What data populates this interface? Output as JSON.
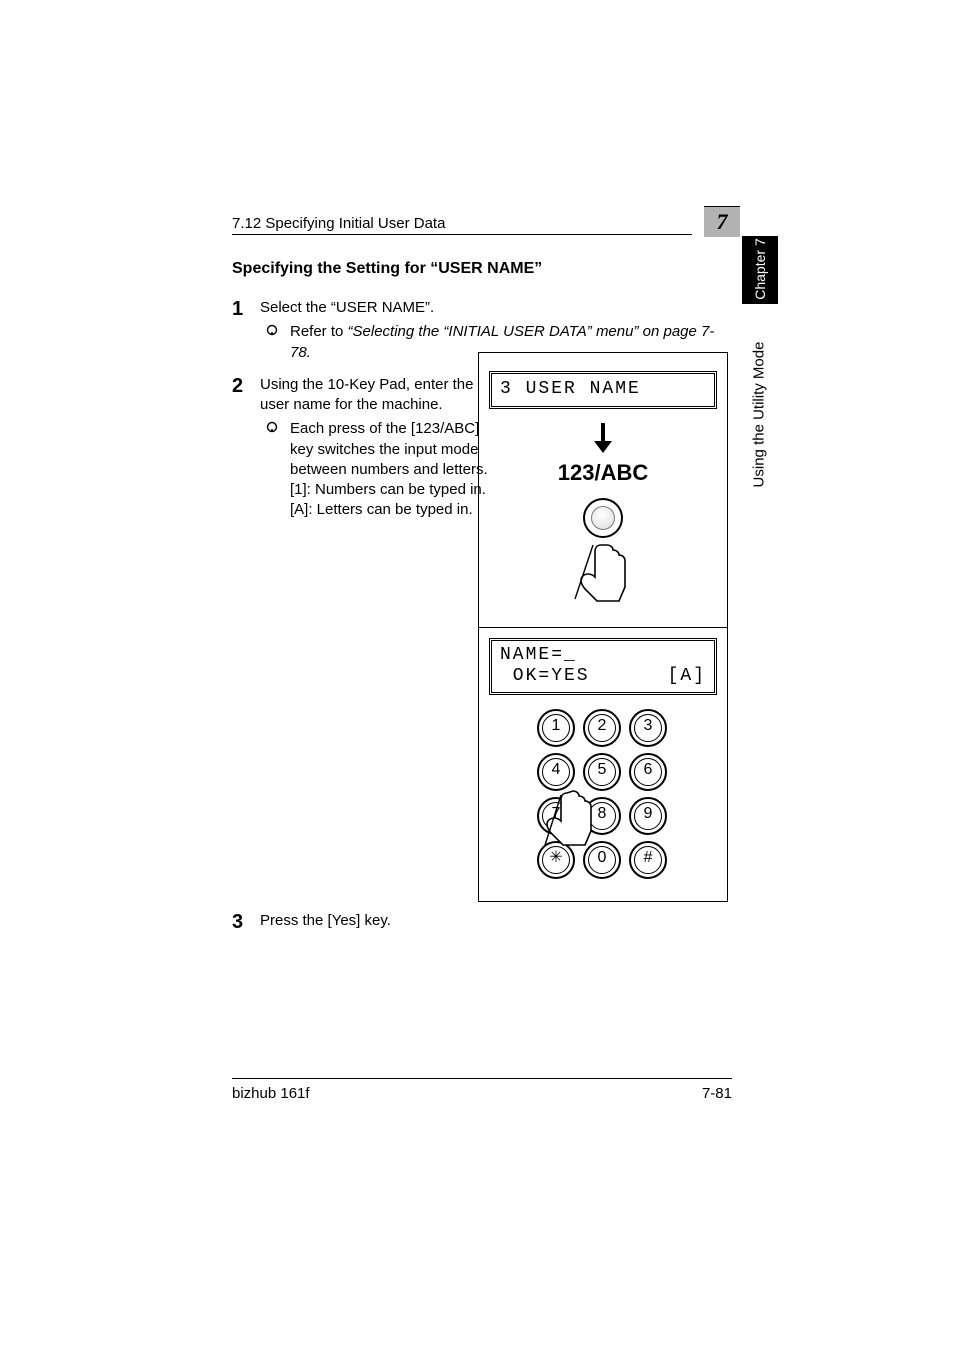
{
  "running_head": "7.12 Specifying Initial User Data",
  "chapter_number": "7",
  "chapter_tab": "Chapter 7",
  "side_label": "Using the Utility Mode",
  "heading": "Specifying the Setting for “USER NAME”",
  "steps": {
    "s1": {
      "num": "1",
      "text": "Select the “USER NAME”.",
      "sub": "Refer to ",
      "ref": "“Selecting the “INITIAL USER DATA” menu” on page 7-78.",
      "refend": ""
    },
    "s2": {
      "num": "2",
      "text": "Using the 10-Key Pad, enter the user name for the machine.",
      "sub1": "Each press of the [123/ABC] key switches the input mode between numbers and letters.",
      "sub2": "[1]: Numbers can be typed in.",
      "sub3": "[A]: Letters can be typed in."
    },
    "s3": {
      "num": "3",
      "text": "Press the [Yes] key."
    }
  },
  "fig": {
    "lcd1": "3 USER NAME",
    "key_label": "123/ABC",
    "lcd2_line1": "NAME=_",
    "lcd2_line2_left": " OK=YES",
    "lcd2_line2_right": "[A]",
    "keys": [
      "1",
      "2",
      "3",
      "4",
      "5",
      "6",
      "7",
      "8",
      "9",
      "✳",
      "0",
      "#"
    ]
  },
  "footer": {
    "left": "bizhub 161f",
    "right": "7-81"
  }
}
